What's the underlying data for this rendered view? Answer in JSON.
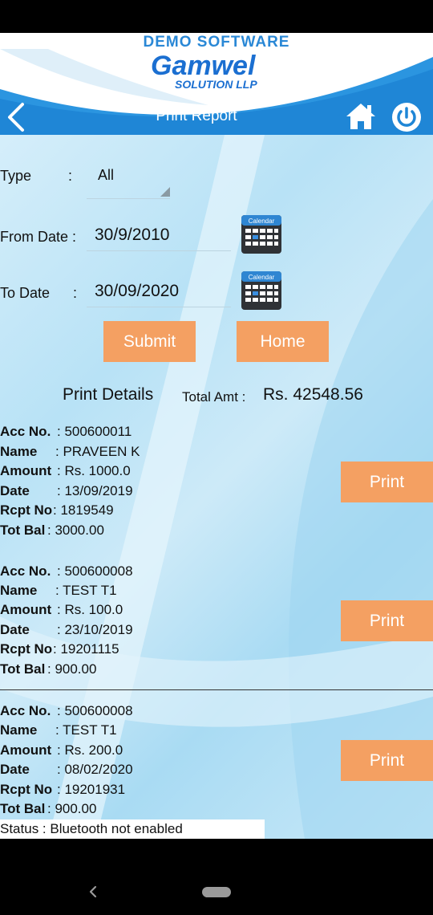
{
  "header": {
    "brand_top": "DEMO SOFTWARE",
    "brand_name": "Gamwel",
    "brand_sub": "SOLUTION LLP",
    "title": "Print Report",
    "icons": [
      "back-arrow-icon",
      "home-icon",
      "power-icon"
    ]
  },
  "form": {
    "type_label": "Type",
    "type_colon": ":",
    "type_value": "All",
    "from_label": "From Date :",
    "from_value": "30/9/2010",
    "to_label": "To Date",
    "to_colon": ":",
    "to_value": "30/09/2020",
    "calendar_text": "Calendar",
    "submit_label": "Submit",
    "home_label": "Home"
  },
  "details": {
    "title": "Print Details",
    "total_label": "Total Amt :",
    "total_value": "Rs. 42548.56"
  },
  "field_labels": {
    "acc": "Acc No.",
    "name": "Name",
    "amount": "Amount",
    "date": "Date",
    "rcpt": "Rcpt No",
    "bal": "Tot Bal"
  },
  "records": [
    {
      "acc": ": 500600011",
      "name": ": PRAVEEN  K",
      "amount": ": Rs. 1000.0",
      "date": ": 13/09/2019",
      "rcpt": ": 1819549",
      "bal": ":   3000.00",
      "print_label": "Print"
    },
    {
      "acc": ": 500600008",
      "name": ": TEST T1",
      "amount": ": Rs. 100.0",
      "date": ": 23/10/2019",
      "rcpt": ": 19201115",
      "bal": ":   900.00",
      "print_label": "Print"
    },
    {
      "acc": ": 500600008",
      "name": ": TEST T1",
      "amount": ": Rs. 200.0",
      "date": ": 08/02/2020",
      "rcpt": ": 19201931",
      "bal": ":   900.00",
      "print_label": "Print"
    }
  ],
  "status": "Status : Bluetooth not enabled",
  "colors": {
    "brand_blue": "#1b6fd1",
    "nav_blue": "#1f8fdc",
    "button_orange": "#f4a062",
    "content_bg": "#c9e9f8"
  }
}
